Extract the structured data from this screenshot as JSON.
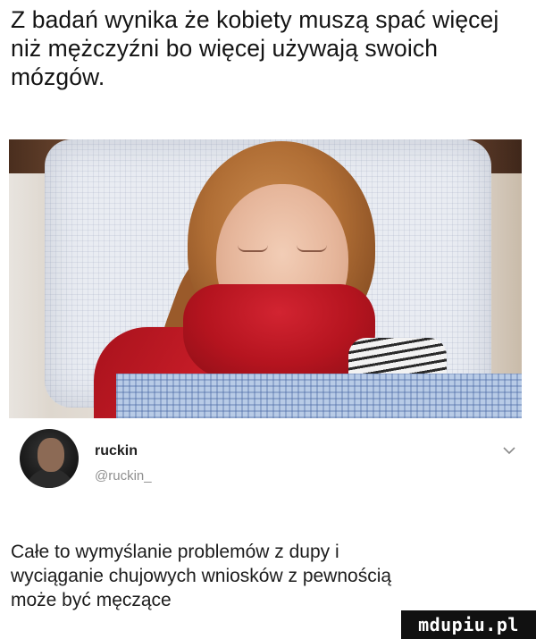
{
  "post": {
    "caption": "Z badań wynika że kobiety muszą spać więcej niż mężczyźni bo więcej używają swoich mózgów."
  },
  "comment": {
    "username": "ruckin",
    "handle": "@ruckin_",
    "text": "Całe to wymyślanie problemów z dupy i wyciąganie chujowych wniosków z pewnością może być męczące"
  },
  "watermark": "mdupiu.pl",
  "icons": {
    "menu": "chevron-down-icon"
  },
  "colors": {
    "text": "#141414",
    "handle": "#8f8f8f",
    "watermark_bg": "#111111"
  }
}
